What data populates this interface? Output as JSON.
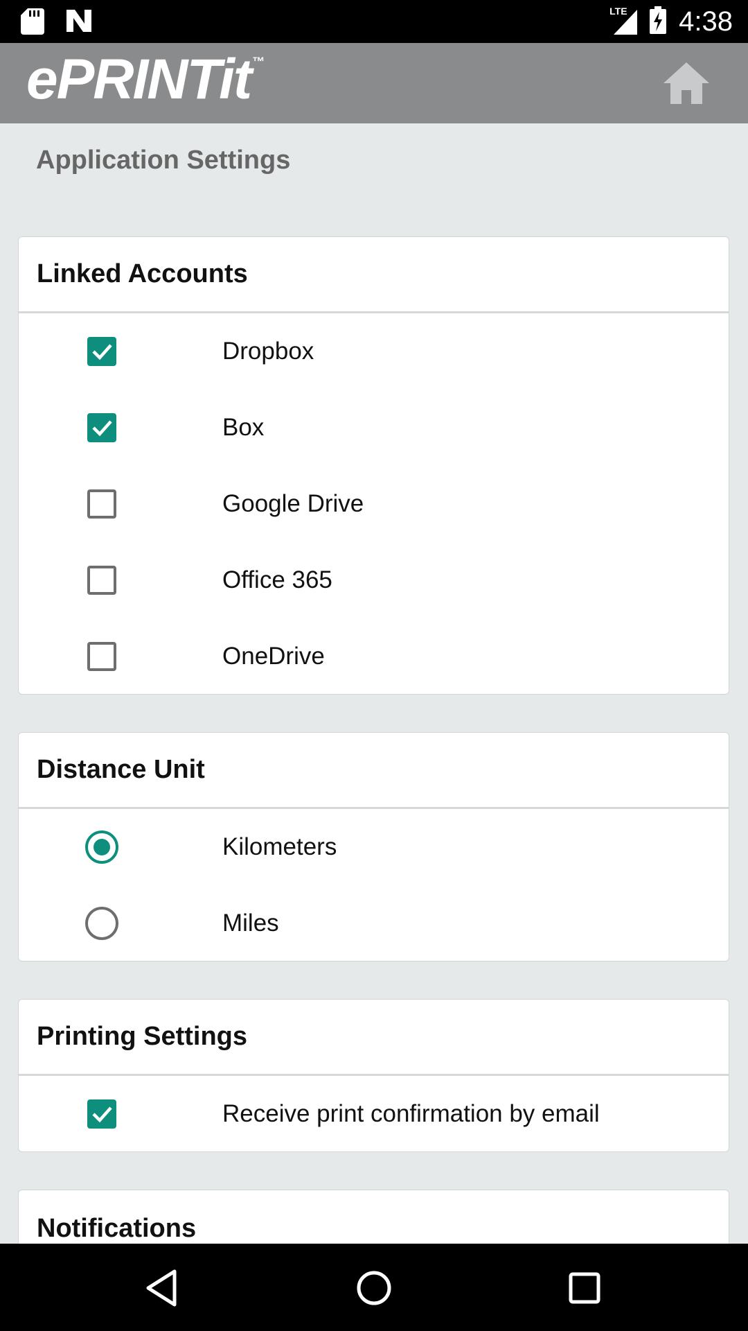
{
  "status_bar": {
    "time": "4:38",
    "network": "LTE",
    "icons": [
      "sd-card-icon",
      "n-logo-icon",
      "signal-icon",
      "battery-charging-icon"
    ]
  },
  "app_bar": {
    "logo_text": "ePRINTit",
    "logo_tm": "™",
    "home_icon": "home-icon"
  },
  "page": {
    "title": "Application Settings"
  },
  "colors": {
    "accent": "#0e8f7e",
    "app_bar": "#8a8b8d",
    "background": "#e6e9ea"
  },
  "linked_accounts": {
    "header": "Linked Accounts",
    "items": [
      {
        "label": "Dropbox",
        "checked": true
      },
      {
        "label": "Box",
        "checked": true
      },
      {
        "label": "Google Drive",
        "checked": false
      },
      {
        "label": "Office 365",
        "checked": false
      },
      {
        "label": "OneDrive",
        "checked": false
      }
    ]
  },
  "distance_unit": {
    "header": "Distance Unit",
    "options": [
      {
        "label": "Kilometers",
        "selected": true
      },
      {
        "label": "Miles",
        "selected": false
      }
    ]
  },
  "printing_settings": {
    "header": "Printing Settings",
    "items": [
      {
        "label": "Receive print confirmation by email",
        "checked": true
      }
    ]
  },
  "notifications": {
    "header": "Notifications"
  },
  "nav_bar": {
    "icons": [
      "back-icon",
      "home-circle-icon",
      "recents-icon"
    ]
  }
}
